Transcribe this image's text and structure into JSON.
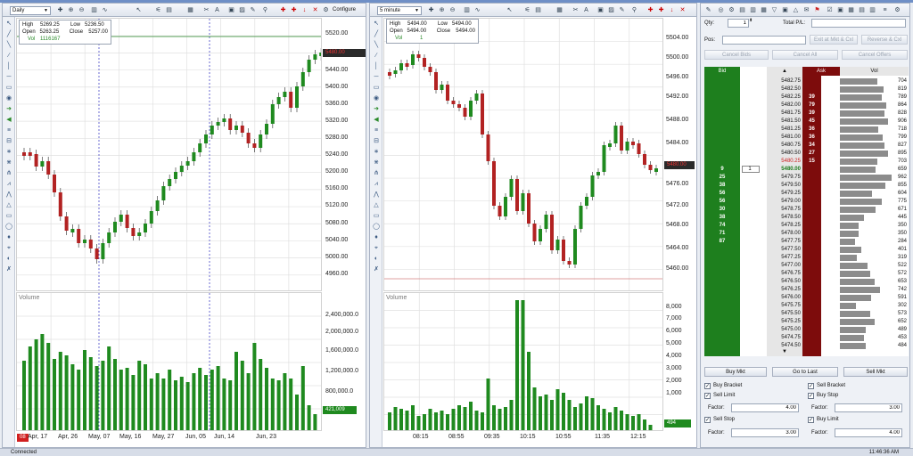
{
  "statusbar": {
    "status": "Connected",
    "time": "11:46:36 AM"
  },
  "left_chart": {
    "toolbar": {
      "timeframe": "Daily",
      "configure": "Configure"
    },
    "info": {
      "high_label": "High",
      "high": "5269.25",
      "low_label": "Low",
      "low": "5236.50",
      "open_label": "Open",
      "open": "5263.25",
      "close_label": "Close",
      "close": "5257.00",
      "vol_label": "Vol",
      "vol": "1116167"
    },
    "price_axis": [
      "5520.00",
      "5440.00",
      "5400.00",
      "5360.00",
      "5320.00",
      "5280.00",
      "5240.00",
      "5200.00",
      "5160.00",
      "5120.00",
      "5080.00",
      "5040.00",
      "5000.00",
      "4960.00"
    ],
    "last_price": "5480.00",
    "volume_label": "Volume",
    "volume_axis": [
      "2,400,000.0",
      "2,000,000.0",
      "1,600,000.0",
      "1,200,000.0",
      "800,000.0"
    ],
    "last_volume": "421,009",
    "date_marker": "08",
    "date_axis": [
      "Apr, 17",
      "Apr, 26",
      "May, 07",
      "May, 16",
      "May, 27",
      "Jun, 05",
      "Jun, 14",
      "Jun, 23"
    ]
  },
  "right_chart": {
    "toolbar": {
      "timeframe": "5 minute"
    },
    "info": {
      "high_label": "High",
      "high": "5494.00",
      "low_label": "Low",
      "low": "5494.00",
      "open_label": "Open",
      "open": "5494.00",
      "close_label": "Close",
      "close": "5494.00",
      "vol_label": "Vol",
      "vol": "1"
    },
    "price_axis": [
      "5504.00",
      "5500.00",
      "5496.00",
      "5492.00",
      "5488.00",
      "5484.00",
      "5476.00",
      "5472.00",
      "5468.00",
      "5464.00",
      "5460.00"
    ],
    "last_price": "5480.00",
    "volume_label": "Volume",
    "volume_axis": [
      "8,000",
      "7,000",
      "6,000",
      "5,000",
      "4,000",
      "3,000",
      "2,000",
      "1,000"
    ],
    "last_volume": "494",
    "time_axis": [
      "08:15",
      "08:55",
      "09:35",
      "10:15",
      "10:55",
      "11:35",
      "12:15"
    ]
  },
  "dom": {
    "qty_label": "Qty:",
    "qty": "1",
    "total_pl_label": "Total P/L:",
    "pos_label": "Pos:",
    "buttons": {
      "exit_at_mkt": "Exit at Mkt & Cxl",
      "reverse": "Reverse & Cxl",
      "cancel_bids": "Cancel Bids",
      "cancel_all": "Cancel All",
      "cancel_offers": "Cancel Offers",
      "buy_mkt": "Buy Mkt",
      "go_to_last": "Go to Last",
      "sell_mkt": "Sell Mkt"
    },
    "headers": {
      "bid": "Bid",
      "ask": "Ask",
      "vol": "Vol"
    },
    "rows": [
      {
        "price": "5482.75",
        "bid": "",
        "ask": "",
        "vol": "704"
      },
      {
        "price": "5482.50",
        "bid": "",
        "ask": "",
        "vol": "819"
      },
      {
        "price": "5482.25",
        "bid": "",
        "ask": "39",
        "vol": "789"
      },
      {
        "price": "5482.00",
        "bid": "",
        "ask": "79",
        "vol": "864"
      },
      {
        "price": "5481.75",
        "bid": "",
        "ask": "39",
        "vol": "828"
      },
      {
        "price": "5481.50",
        "bid": "",
        "ask": "45",
        "vol": "906"
      },
      {
        "price": "5481.25",
        "bid": "",
        "ask": "36",
        "vol": "718"
      },
      {
        "price": "5481.00",
        "bid": "",
        "ask": "36",
        "vol": "799"
      },
      {
        "price": "5480.75",
        "bid": "",
        "ask": "34",
        "vol": "827"
      },
      {
        "price": "5480.50",
        "bid": "",
        "ask": "27",
        "vol": "895"
      },
      {
        "price": "5480.25",
        "bid": "",
        "ask": "15",
        "vol": "703"
      },
      {
        "price": "5480.00",
        "bid": "9",
        "ask": "",
        "vol": "659",
        "pos": "1"
      },
      {
        "price": "5479.75",
        "bid": "25",
        "ask": "",
        "vol": "962"
      },
      {
        "price": "5479.50",
        "bid": "38",
        "ask": "",
        "vol": "855"
      },
      {
        "price": "5479.25",
        "bid": "56",
        "ask": "",
        "vol": "604"
      },
      {
        "price": "5479.00",
        "bid": "56",
        "ask": "",
        "vol": "775"
      },
      {
        "price": "5478.75",
        "bid": "30",
        "ask": "",
        "vol": "671"
      },
      {
        "price": "5478.50",
        "bid": "38",
        "ask": "",
        "vol": "445"
      },
      {
        "price": "5478.25",
        "bid": "74",
        "ask": "",
        "vol": "350"
      },
      {
        "price": "5478.00",
        "bid": "71",
        "ask": "",
        "vol": "350"
      },
      {
        "price": "5477.75",
        "bid": "87",
        "ask": "",
        "vol": "284"
      },
      {
        "price": "5477.50",
        "bid": "",
        "ask": "",
        "vol": "401"
      },
      {
        "price": "5477.25",
        "bid": "",
        "ask": "",
        "vol": "319"
      },
      {
        "price": "5477.00",
        "bid": "",
        "ask": "",
        "vol": "522"
      },
      {
        "price": "5476.75",
        "bid": "",
        "ask": "",
        "vol": "572"
      },
      {
        "price": "5476.50",
        "bid": "",
        "ask": "",
        "vol": "653"
      },
      {
        "price": "5476.25",
        "bid": "",
        "ask": "",
        "vol": "742"
      },
      {
        "price": "5476.00",
        "bid": "",
        "ask": "",
        "vol": "591"
      },
      {
        "price": "5475.75",
        "bid": "",
        "ask": "",
        "vol": "302"
      },
      {
        "price": "5475.50",
        "bid": "",
        "ask": "",
        "vol": "573"
      },
      {
        "price": "5475.25",
        "bid": "",
        "ask": "",
        "vol": "652"
      },
      {
        "price": "5475.00",
        "bid": "",
        "ask": "",
        "vol": "489"
      },
      {
        "price": "5474.75",
        "bid": "",
        "ask": "",
        "vol": "453"
      },
      {
        "price": "5474.50",
        "bid": "",
        "ask": "",
        "vol": "484"
      }
    ],
    "options": {
      "buy_bracket": "Buy Bracket",
      "sell_bracket": "Sell Bracket",
      "sell_limit": "Sell Limit",
      "buy_stop": "Buy Stop",
      "factor_label": "Factor:",
      "factor1": "4.00",
      "factor2": "3.00",
      "sell_stop": "Sell Stop",
      "buy_limit": "Buy Limit",
      "factor3": "3.00",
      "factor4": "4.00"
    }
  },
  "colors": {
    "up": "#1f8a1f",
    "down": "#b22222",
    "bid_green": "#188a18",
    "ask_red": "#8e0e0e",
    "vol_bar": "#8c8c8c",
    "price_tag": "#2a2a2a"
  }
}
